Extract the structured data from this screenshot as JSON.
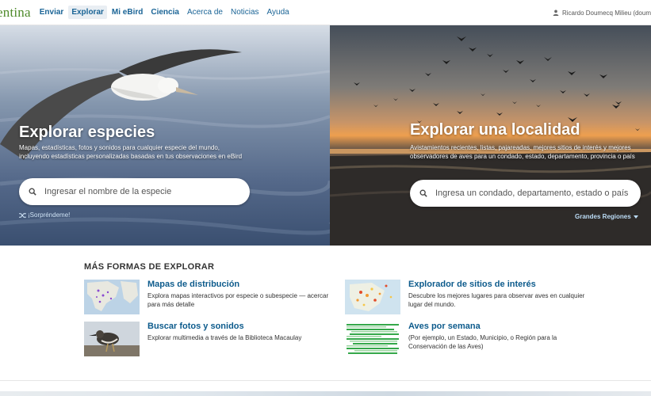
{
  "nav": {
    "logo": "entina",
    "items": [
      {
        "label": "Enviar"
      },
      {
        "label": "Explorar"
      },
      {
        "label": "Mi eBird"
      },
      {
        "label": "Ciencia"
      },
      {
        "label": "Acerca de"
      },
      {
        "label": "Noticias"
      },
      {
        "label": "Ayuda"
      }
    ],
    "user": "Ricardo Doumecq Milieu (doum"
  },
  "species": {
    "title": "Explorar especies",
    "description": "Mapas, estadísticas, fotos y sonidos para cualquier especie del mundo, incluyendo estadísticas personalizadas basadas en tus observaciones en eBird",
    "search_placeholder": "Ingresar el nombre de la especie",
    "surprise_link": "¡Sorpréndeme!"
  },
  "locality": {
    "title": "Explorar una localidad",
    "description": "Avistamientos recientes, listas, pajareadas, mejores sitios de interés y mejores observadores de aves para un condado, estado, departamento, provincia o país",
    "search_placeholder": "Ingresa un condado, departamento, estado o país",
    "regions_link": "Grandes Regiones"
  },
  "more": {
    "title": "MÁS FORMAS DE EXPLORAR",
    "cards": [
      {
        "title": "Mapas de distribución",
        "description": "Explora mapas interactivos por especie o subespecie — acercar para más detalle"
      },
      {
        "title": "Explorador de sitios de interés",
        "description": "Descubre los mejores lugares para observar aves en cualquier lugar del mundo."
      },
      {
        "title": "Buscar fotos y sonidos",
        "description": "Explorar multimedia a través de la Biblioteca Macaulay"
      },
      {
        "title": "Aves por semana",
        "description": "(Por ejemplo, un Estado, Municipio, o Región para la Conservación de las Aves)"
      }
    ]
  },
  "colors": {
    "link_blue": "#0d5b8c",
    "logo_green": "#4e8a2a"
  }
}
